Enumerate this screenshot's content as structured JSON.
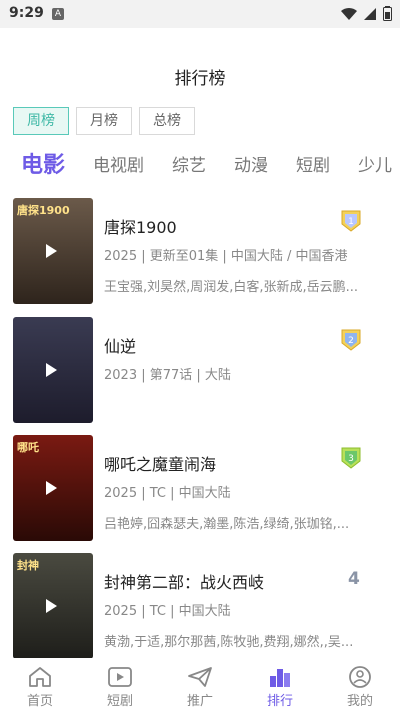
{
  "status_bar": {
    "time": "9:29",
    "notification_letter": "A"
  },
  "header": {
    "title": "排行榜"
  },
  "period_tabs": [
    {
      "label": "周榜",
      "active": true
    },
    {
      "label": "月榜",
      "active": false
    },
    {
      "label": "总榜",
      "active": false
    }
  ],
  "category_tabs": [
    {
      "label": "电影",
      "active": true
    },
    {
      "label": "电视剧",
      "active": false
    },
    {
      "label": "综艺",
      "active": false
    },
    {
      "label": "动漫",
      "active": false
    },
    {
      "label": "短剧",
      "active": false
    },
    {
      "label": "少儿",
      "active": false
    }
  ],
  "items": [
    {
      "rank": "1",
      "title": "唐探1900",
      "meta": "2025 | 更新至01集 | 中国大陆 / 中国香港",
      "cast": "王宝强,刘昊然,周润发,白客,张新成,岳云鹏...",
      "poster_text": "唐探1900",
      "poster_color_top": "#6b5a4a",
      "poster_color_bottom": "#2e241c",
      "badge": "gold"
    },
    {
      "rank": "2",
      "title": "仙逆",
      "meta": "2023 | 第77话 | 大陆",
      "cast": "",
      "poster_text": "",
      "poster_color_top": "#3a3b52",
      "poster_color_bottom": "#1d1c2c",
      "badge": "gold"
    },
    {
      "rank": "3",
      "title": "哪吒之魔童闹海",
      "meta": "2025 | TC | 中国大陆",
      "cast": "吕艳婷,囧森瑟夫,瀚墨,陈浩,绿绮,张珈铭,...",
      "poster_text": "哪吒",
      "poster_color_top": "#7a1a12",
      "poster_color_bottom": "#2a0a06",
      "badge": "green"
    },
    {
      "rank": "4",
      "title": "封神第二部：战火西岐",
      "meta": "2025 | TC | 中国大陆",
      "cast": "黄渤,于适,那尔那茜,陈牧驰,费翔,娜然,,吴...",
      "poster_text": "封神",
      "poster_color_top": "#4a4a40",
      "poster_color_bottom": "#1e1e1a",
      "badge": "none"
    }
  ],
  "bottom_nav": [
    {
      "label": "首页",
      "icon": "home-icon",
      "active": false
    },
    {
      "label": "短剧",
      "icon": "play-icon",
      "active": false
    },
    {
      "label": "推广",
      "icon": "paper-plane-icon",
      "active": false
    },
    {
      "label": "排行",
      "icon": "ranking-icon",
      "active": true
    },
    {
      "label": "我的",
      "icon": "profile-icon",
      "active": false
    }
  ],
  "colors": {
    "accent": "#6e5be6",
    "period_active": "#3fb8a6"
  }
}
